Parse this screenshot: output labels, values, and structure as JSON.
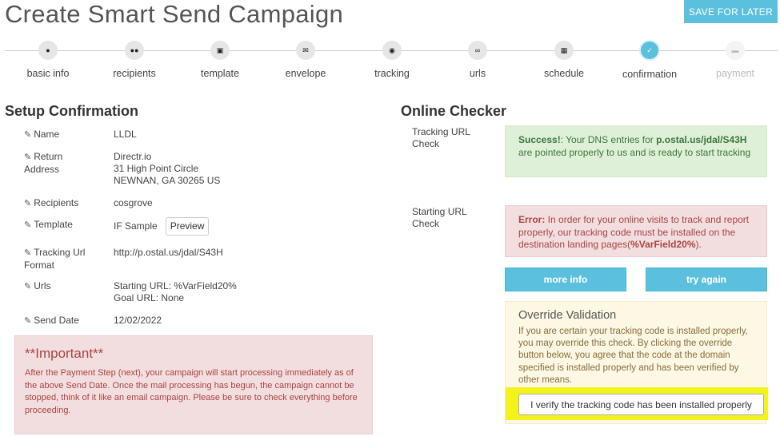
{
  "header": {
    "title": "Create Smart Send Campaign",
    "save_later_label": "SAVE FOR LATER"
  },
  "wizard": {
    "steps": [
      {
        "label": "basic info",
        "icon": "user-icon"
      },
      {
        "label": "recipients",
        "icon": "users-icon"
      },
      {
        "label": "template",
        "icon": "image-file-icon"
      },
      {
        "label": "envelope",
        "icon": "envelope-icon"
      },
      {
        "label": "tracking",
        "icon": "target-icon"
      },
      {
        "label": "urls",
        "icon": "link-icon"
      },
      {
        "label": "schedule",
        "icon": "calendar-icon"
      },
      {
        "label": "confirmation",
        "icon": "check-icon",
        "state": "active"
      },
      {
        "label": "payment",
        "icon": "credit-card-icon",
        "state": "disabled"
      }
    ]
  },
  "setup": {
    "title": "Setup Confirmation",
    "rows": [
      {
        "label": "Name",
        "value": [
          "LLDL"
        ]
      },
      {
        "label_lines": [
          "Return",
          "Address"
        ],
        "value": [
          "Directr.io",
          "31 High Point Circle",
          "NEWNAN, GA 30265 US"
        ]
      },
      {
        "label": "Recipients",
        "value": [
          "cosgrove"
        ]
      },
      {
        "label": "Template",
        "value": [
          "IF Sample"
        ],
        "button": "Preview"
      },
      {
        "label_lines": [
          "Tracking Url",
          "Format"
        ],
        "value": [
          "http://p.ostal.us/jdal/S43H"
        ]
      },
      {
        "label": "Urls",
        "value": [
          "Starting URL: %VarField20%",
          "Goal URL: None"
        ]
      },
      {
        "label": "Send Date",
        "value": [
          "12/02/2022"
        ]
      }
    ]
  },
  "important": {
    "title": "**Important**",
    "text": "After the Payment Step (next), your campaign will start processing immediately as of the above Send Date. Once the mail processing has begun, the campaign cannot be stopped, think of it like an email campaign. Please be sure to check everything before proceeding."
  },
  "checker": {
    "title": "Online Checker",
    "tracking_label_lines": [
      "Tracking URL",
      "Check"
    ],
    "starting_label_lines": [
      "Starting URL",
      "Check"
    ],
    "success": {
      "prefix": "Success!",
      "text_a": ": Your DNS entries for ",
      "domain": "p.ostal.us/jdal/S43H",
      "text_b": " are pointed properly to us and is ready to start tracking"
    },
    "error": {
      "prefix": "Error:",
      "text_a": " In order for your online visits to track and report properly, our tracking code must be installed on the destination landing pages(",
      "field": "%VarField20%",
      "text_b": ")."
    },
    "more_info_label": "more info",
    "try_again_label": "try again",
    "override": {
      "title": "Override Validation",
      "text": "If you are certain your tracking code is installed properly, you may override this check. By clicking the override button below, you agree that the code at the domain specified is installed properly and has been verified by other means.",
      "button_label": "I verify the tracking code has been installed properly"
    }
  },
  "colors": {
    "accent": "#5bc0de",
    "success_bg": "#dff0d8",
    "danger_bg": "#f2dede",
    "warning_bg": "#fcf8e3",
    "highlight": "#f3f21b"
  }
}
